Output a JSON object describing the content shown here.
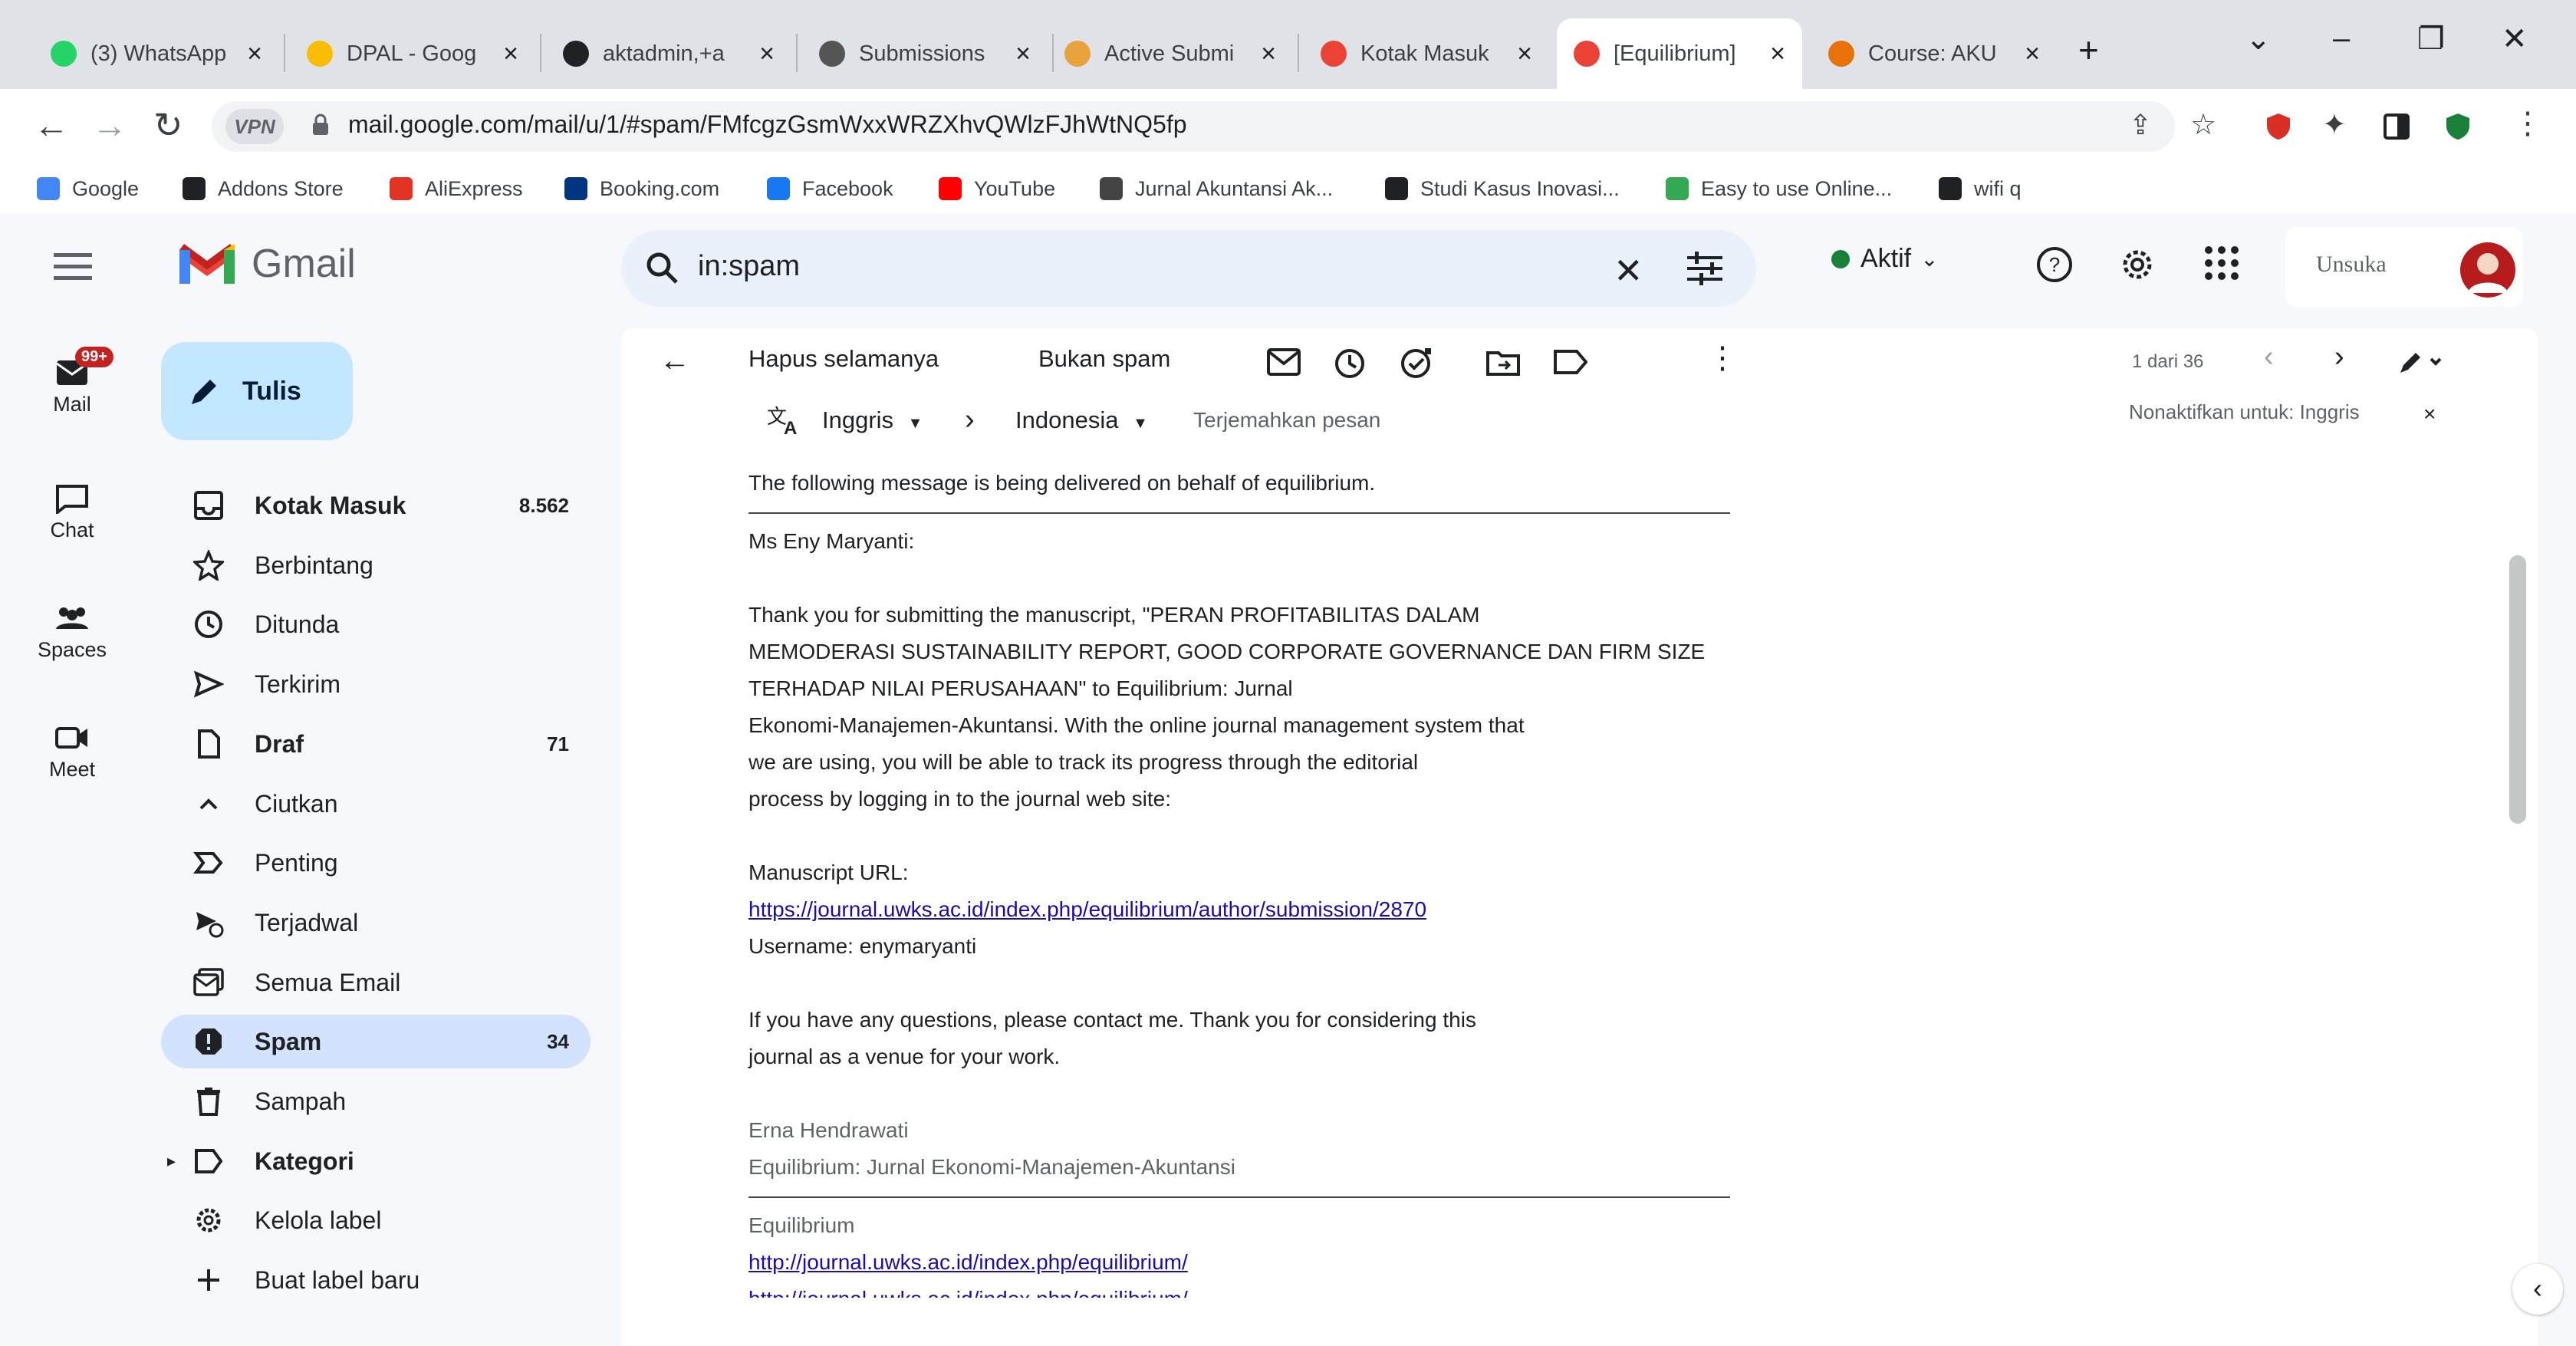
{
  "browser": {
    "tabs": [
      {
        "title": "(3) WhatsApp",
        "color": "#25d366"
      },
      {
        "title": "DPAL - Goog",
        "color": "#fbbc04"
      },
      {
        "title": "aktadmin,+a",
        "color": "#202124"
      },
      {
        "title": "Submissions",
        "color": "#555555"
      },
      {
        "title": "Active Submi",
        "color": "#e8a33d"
      },
      {
        "title": "Kotak Masuk",
        "color": "#ea4335"
      },
      {
        "title": "[Equilibrium]",
        "color": "#ea4335"
      },
      {
        "title": "Course: AKU",
        "color": "#e8710a"
      }
    ],
    "active_tab": 6,
    "vpn_label": "VPN",
    "url": "mail.google.com/mail/u/1/#spam/FMfcgzGsmWxxWRZXhvQWlzFJhWtNQ5fp",
    "bookmarks": [
      {
        "label": "Google",
        "color": "#4285f4"
      },
      {
        "label": "Addons Store",
        "color": "#202124"
      },
      {
        "label": "AliExpress",
        "color": "#e43225"
      },
      {
        "label": "Booking.com",
        "color": "#003580"
      },
      {
        "label": "Facebook",
        "color": "#1877f2"
      },
      {
        "label": "YouTube",
        "color": "#ff0000"
      },
      {
        "label": "Jurnal Akuntansi Ak...",
        "color": "#444444"
      },
      {
        "label": "Studi Kasus Inovasi...",
        "color": "#202124"
      },
      {
        "label": "Easy to use Online...",
        "color": "#34a853"
      },
      {
        "label": "wifi q",
        "color": "#202124"
      }
    ]
  },
  "gmail": {
    "brand": "Gmail",
    "rail": [
      {
        "label": "Mail",
        "badge": "99+",
        "icon": "mail-icon"
      },
      {
        "label": "Chat",
        "icon": "chat-icon"
      },
      {
        "label": "Spaces",
        "icon": "spaces-icon"
      },
      {
        "label": "Meet",
        "icon": "meet-icon"
      }
    ],
    "compose_label": "Tulis",
    "nav": [
      {
        "label": "Kotak Masuk",
        "count": "8.562",
        "icon": "inbox-icon",
        "bold": true
      },
      {
        "label": "Berbintang",
        "count": "",
        "icon": "star-icon"
      },
      {
        "label": "Ditunda",
        "count": "",
        "icon": "clock-icon"
      },
      {
        "label": "Terkirim",
        "count": "",
        "icon": "send-icon"
      },
      {
        "label": "Draf",
        "count": "71",
        "icon": "draft-icon",
        "bold": true
      },
      {
        "label": "Ciutkan",
        "count": "",
        "icon": "chevron-up-icon"
      },
      {
        "label": "Penting",
        "count": "",
        "icon": "important-icon"
      },
      {
        "label": "Terjadwal",
        "count": "",
        "icon": "scheduled-icon"
      },
      {
        "label": "Semua Email",
        "count": "",
        "icon": "all-mail-icon"
      },
      {
        "label": "Spam",
        "count": "34",
        "icon": "spam-icon",
        "bold": true,
        "selected": true
      },
      {
        "label": "Sampah",
        "count": "",
        "icon": "trash-icon"
      },
      {
        "label": "Kategori",
        "count": "",
        "icon": "label-icon",
        "bold": true
      },
      {
        "label": "Kelola label",
        "count": "",
        "icon": "gear-icon"
      },
      {
        "label": "Buat label baru",
        "count": "",
        "icon": "plus-icon"
      }
    ],
    "search_query": "in:spam",
    "status_label": "Aktif",
    "status_color": "#188038",
    "account_label": "Unsuka",
    "toolbar": {
      "delete_forever": "Hapus selamanya",
      "not_spam": "Bukan spam",
      "page_info": "1 dari 36"
    },
    "translate": {
      "from": "Inggris",
      "to": "Indonesia",
      "action": "Terjemahkan pesan",
      "disable": "Nonaktifkan untuk: Inggris"
    },
    "message": {
      "intro": "The following message is being delivered on behalf of equilibrium.",
      "salutation": "Ms Eny Maryanti:",
      "para1": [
        "Thank you for submitting the manuscript, \"PERAN PROFITABILITAS DALAM",
        "MEMODERASI SUSTAINABILITY REPORT, GOOD CORPORATE GOVERNANCE DAN FIRM SIZE",
        "TERHADAP NILAI PERUSAHAAN\" to Equilibrium: Jurnal",
        "Ekonomi-Manajemen-Akuntansi. With the online journal management system that",
        "we are using, you will be able to track its progress through the editorial",
        "process by logging in to the journal web site:"
      ],
      "url_label": "Manuscript URL:",
      "url": "https://journal.uwks.ac.id/index.php/equilibrium/author/submission/2870",
      "username": "Username: enymaryanti",
      "para2": [
        "If you have any questions, please contact me. Thank you for considering this",
        "journal as a venue for your work."
      ],
      "sig_name": "Erna Hendrawati",
      "sig_journal": "Equilibrium: Jurnal Ekonomi-Manajemen-Akuntansi",
      "footer_name": "Equilibrium",
      "footer_link": "http://journal.uwks.ac.id/index.php/equilibrium/",
      "footer_link_cut": "http://journal.uwks.ac.id/index.php/equilibrium/"
    }
  }
}
